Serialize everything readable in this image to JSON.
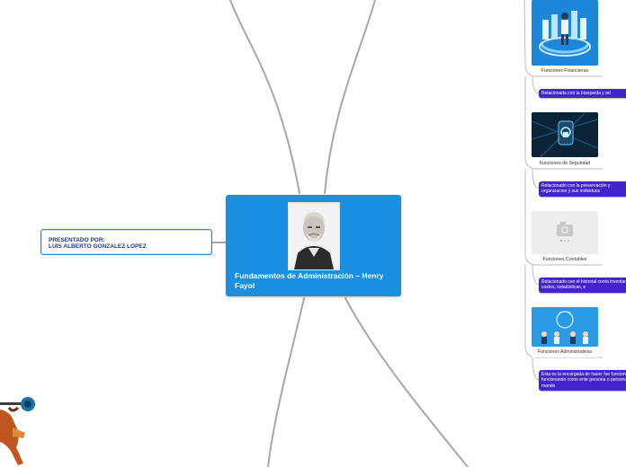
{
  "central": {
    "title": "Fundamentos de Administración – Henry Fayol"
  },
  "presenter": {
    "line1": "PRESENTADO POR:",
    "line2": "LUIS ALBERTO GONZALEZ LOPEZ"
  },
  "functions": [
    {
      "caption": "Funciones Financieras",
      "note": "Relacionada con la búsqueda y ad"
    },
    {
      "caption": "Funciones de Seguridad",
      "note": "Relacionado con la preservación y organizacion y sus individuos"
    },
    {
      "caption": "Funciones Contables",
      "note": "Relacionado con el historial conta inventarios, costos, estadísticas, e"
    },
    {
      "caption": "Funciones Administrativas",
      "note": "Esta es la encargada de hacer fun funciones, funcionando como ente persona o personas al mando"
    }
  ],
  "colors": {
    "central": "#1a8fdf",
    "note": "#4224cf",
    "presenter_border": "#2a85d8",
    "link": "#9aa0a6"
  }
}
